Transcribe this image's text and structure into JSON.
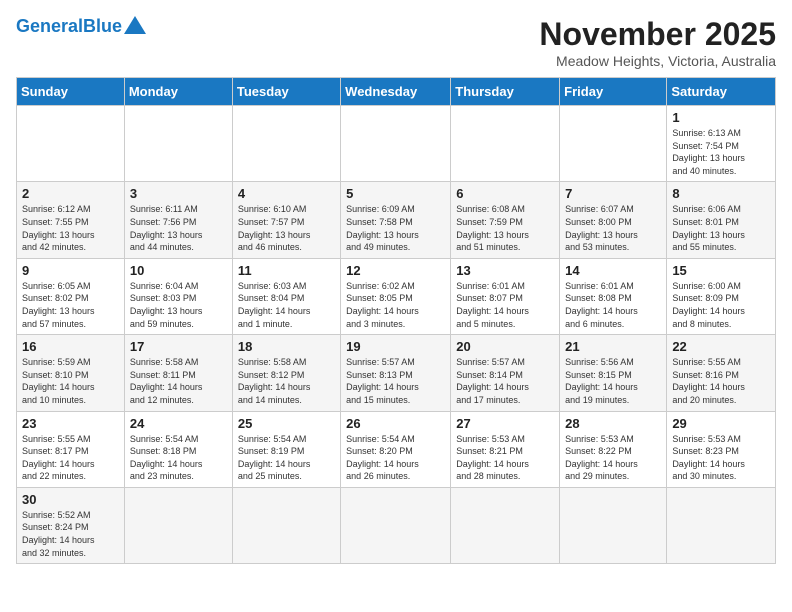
{
  "header": {
    "logo_general": "General",
    "logo_blue": "Blue",
    "month_title": "November 2025",
    "subtitle": "Meadow Heights, Victoria, Australia"
  },
  "weekdays": [
    "Sunday",
    "Monday",
    "Tuesday",
    "Wednesday",
    "Thursday",
    "Friday",
    "Saturday"
  ],
  "weeks": [
    [
      {
        "day": "",
        "info": ""
      },
      {
        "day": "",
        "info": ""
      },
      {
        "day": "",
        "info": ""
      },
      {
        "day": "",
        "info": ""
      },
      {
        "day": "",
        "info": ""
      },
      {
        "day": "",
        "info": ""
      },
      {
        "day": "1",
        "info": "Sunrise: 6:13 AM\nSunset: 7:54 PM\nDaylight: 13 hours\nand 40 minutes."
      }
    ],
    [
      {
        "day": "2",
        "info": "Sunrise: 6:12 AM\nSunset: 7:55 PM\nDaylight: 13 hours\nand 42 minutes."
      },
      {
        "day": "3",
        "info": "Sunrise: 6:11 AM\nSunset: 7:56 PM\nDaylight: 13 hours\nand 44 minutes."
      },
      {
        "day": "4",
        "info": "Sunrise: 6:10 AM\nSunset: 7:57 PM\nDaylight: 13 hours\nand 46 minutes."
      },
      {
        "day": "5",
        "info": "Sunrise: 6:09 AM\nSunset: 7:58 PM\nDaylight: 13 hours\nand 49 minutes."
      },
      {
        "day": "6",
        "info": "Sunrise: 6:08 AM\nSunset: 7:59 PM\nDaylight: 13 hours\nand 51 minutes."
      },
      {
        "day": "7",
        "info": "Sunrise: 6:07 AM\nSunset: 8:00 PM\nDaylight: 13 hours\nand 53 minutes."
      },
      {
        "day": "8",
        "info": "Sunrise: 6:06 AM\nSunset: 8:01 PM\nDaylight: 13 hours\nand 55 minutes."
      }
    ],
    [
      {
        "day": "9",
        "info": "Sunrise: 6:05 AM\nSunset: 8:02 PM\nDaylight: 13 hours\nand 57 minutes."
      },
      {
        "day": "10",
        "info": "Sunrise: 6:04 AM\nSunset: 8:03 PM\nDaylight: 13 hours\nand 59 minutes."
      },
      {
        "day": "11",
        "info": "Sunrise: 6:03 AM\nSunset: 8:04 PM\nDaylight: 14 hours\nand 1 minute."
      },
      {
        "day": "12",
        "info": "Sunrise: 6:02 AM\nSunset: 8:05 PM\nDaylight: 14 hours\nand 3 minutes."
      },
      {
        "day": "13",
        "info": "Sunrise: 6:01 AM\nSunset: 8:07 PM\nDaylight: 14 hours\nand 5 minutes."
      },
      {
        "day": "14",
        "info": "Sunrise: 6:01 AM\nSunset: 8:08 PM\nDaylight: 14 hours\nand 6 minutes."
      },
      {
        "day": "15",
        "info": "Sunrise: 6:00 AM\nSunset: 8:09 PM\nDaylight: 14 hours\nand 8 minutes."
      }
    ],
    [
      {
        "day": "16",
        "info": "Sunrise: 5:59 AM\nSunset: 8:10 PM\nDaylight: 14 hours\nand 10 minutes."
      },
      {
        "day": "17",
        "info": "Sunrise: 5:58 AM\nSunset: 8:11 PM\nDaylight: 14 hours\nand 12 minutes."
      },
      {
        "day": "18",
        "info": "Sunrise: 5:58 AM\nSunset: 8:12 PM\nDaylight: 14 hours\nand 14 minutes."
      },
      {
        "day": "19",
        "info": "Sunrise: 5:57 AM\nSunset: 8:13 PM\nDaylight: 14 hours\nand 15 minutes."
      },
      {
        "day": "20",
        "info": "Sunrise: 5:57 AM\nSunset: 8:14 PM\nDaylight: 14 hours\nand 17 minutes."
      },
      {
        "day": "21",
        "info": "Sunrise: 5:56 AM\nSunset: 8:15 PM\nDaylight: 14 hours\nand 19 minutes."
      },
      {
        "day": "22",
        "info": "Sunrise: 5:55 AM\nSunset: 8:16 PM\nDaylight: 14 hours\nand 20 minutes."
      }
    ],
    [
      {
        "day": "23",
        "info": "Sunrise: 5:55 AM\nSunset: 8:17 PM\nDaylight: 14 hours\nand 22 minutes."
      },
      {
        "day": "24",
        "info": "Sunrise: 5:54 AM\nSunset: 8:18 PM\nDaylight: 14 hours\nand 23 minutes."
      },
      {
        "day": "25",
        "info": "Sunrise: 5:54 AM\nSunset: 8:19 PM\nDaylight: 14 hours\nand 25 minutes."
      },
      {
        "day": "26",
        "info": "Sunrise: 5:54 AM\nSunset: 8:20 PM\nDaylight: 14 hours\nand 26 minutes."
      },
      {
        "day": "27",
        "info": "Sunrise: 5:53 AM\nSunset: 8:21 PM\nDaylight: 14 hours\nand 28 minutes."
      },
      {
        "day": "28",
        "info": "Sunrise: 5:53 AM\nSunset: 8:22 PM\nDaylight: 14 hours\nand 29 minutes."
      },
      {
        "day": "29",
        "info": "Sunrise: 5:53 AM\nSunset: 8:23 PM\nDaylight: 14 hours\nand 30 minutes."
      }
    ],
    [
      {
        "day": "30",
        "info": "Sunrise: 5:52 AM\nSunset: 8:24 PM\nDaylight: 14 hours\nand 32 minutes."
      },
      {
        "day": "",
        "info": ""
      },
      {
        "day": "",
        "info": ""
      },
      {
        "day": "",
        "info": ""
      },
      {
        "day": "",
        "info": ""
      },
      {
        "day": "",
        "info": ""
      },
      {
        "day": "",
        "info": ""
      }
    ]
  ]
}
